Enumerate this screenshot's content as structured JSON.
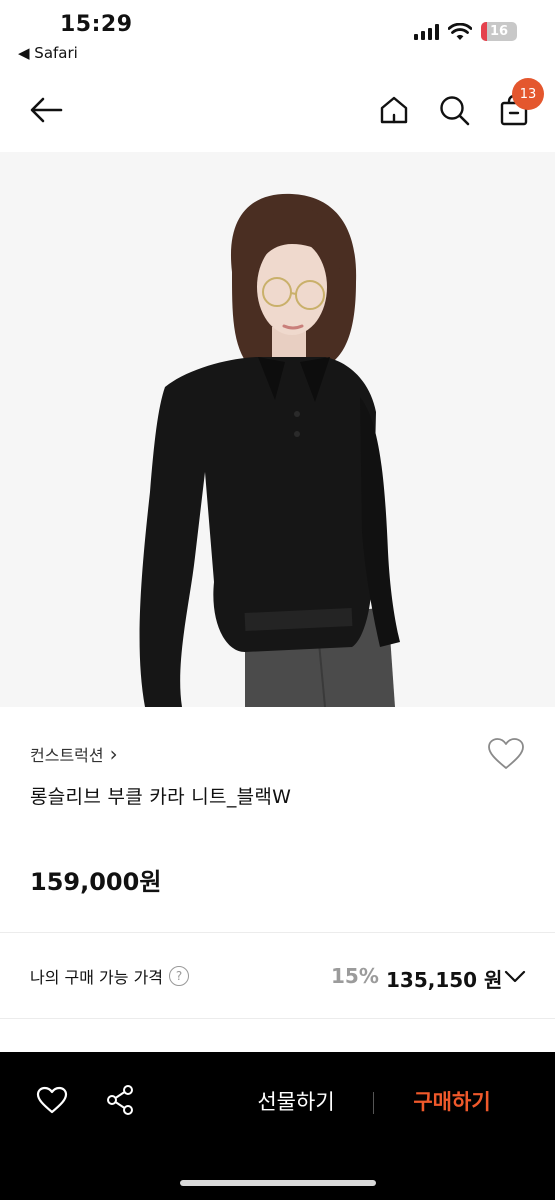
{
  "status_bar": {
    "time": "15:29",
    "back_app": "◀ Safari",
    "battery": "16"
  },
  "nav": {
    "cart_badge": "13",
    "icons": [
      "back-arrow-icon",
      "home-icon",
      "search-icon",
      "shopping-bag-icon"
    ]
  },
  "product": {
    "brand": "컨스트럭션",
    "brand_chevron": "›",
    "name": "롱슬리브 부클 카라 니트_블랙W",
    "price": "159,000원",
    "image": "model-wearing-black-collared-knit"
  },
  "my_price": {
    "label": "나의 구매 가능 가격",
    "help": "?",
    "discount": "15%",
    "final_price": "135,150 원"
  },
  "bottom_bar": {
    "gift_label": "선물하기",
    "buy_label": "구매하기"
  },
  "colors": {
    "accent": "#f0592b",
    "badge": "#e4572e",
    "battery": "#e5424d"
  }
}
